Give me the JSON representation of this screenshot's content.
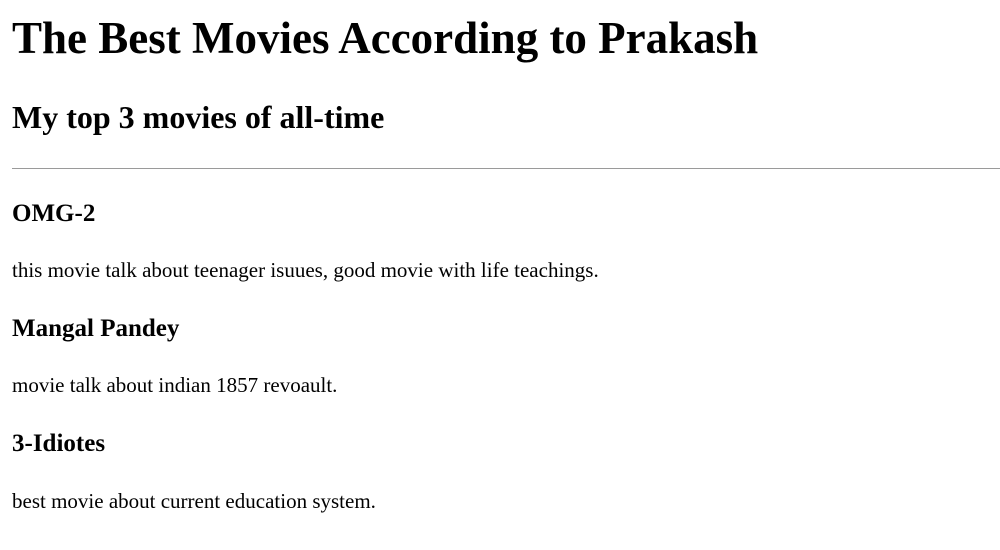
{
  "page": {
    "title": "The Best Movies According to Prakash",
    "subtitle": "My top 3 movies of all-time"
  },
  "movies": [
    {
      "title": "OMG-2",
      "description": "this movie talk about teenager isuues, good movie with life teachings."
    },
    {
      "title": "Mangal Pandey",
      "description": "movie talk about indian 1857 revoault."
    },
    {
      "title": "3-Idiotes",
      "description": "best movie about current education system."
    }
  ],
  "colors": {
    "text": "#000000",
    "background": "#ffffff",
    "divider": "#9a9a9a"
  }
}
